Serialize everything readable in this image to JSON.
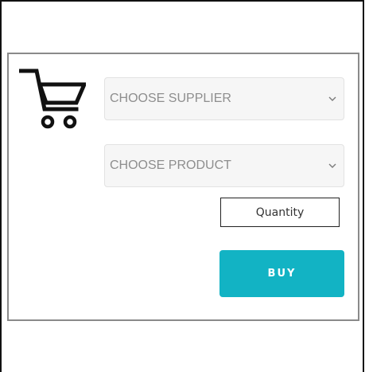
{
  "order_form": {
    "cart_icon": "shopping-cart-icon",
    "supplier_select": {
      "selected": "CHOOSE SUPPLIER",
      "icon": "chevron-down-icon"
    },
    "product_select": {
      "selected": "CHOOSE PRODUCT",
      "icon": "chevron-down-icon"
    },
    "quantity": {
      "placeholder": "Quantity",
      "value": ""
    },
    "buy_label": "BUY"
  },
  "colors": {
    "accent": "#12b3c4",
    "select_bg": "#f6f6f6",
    "select_text": "#8e8e8e",
    "card_border": "#8a8a8a",
    "frame_border": "#111111"
  }
}
